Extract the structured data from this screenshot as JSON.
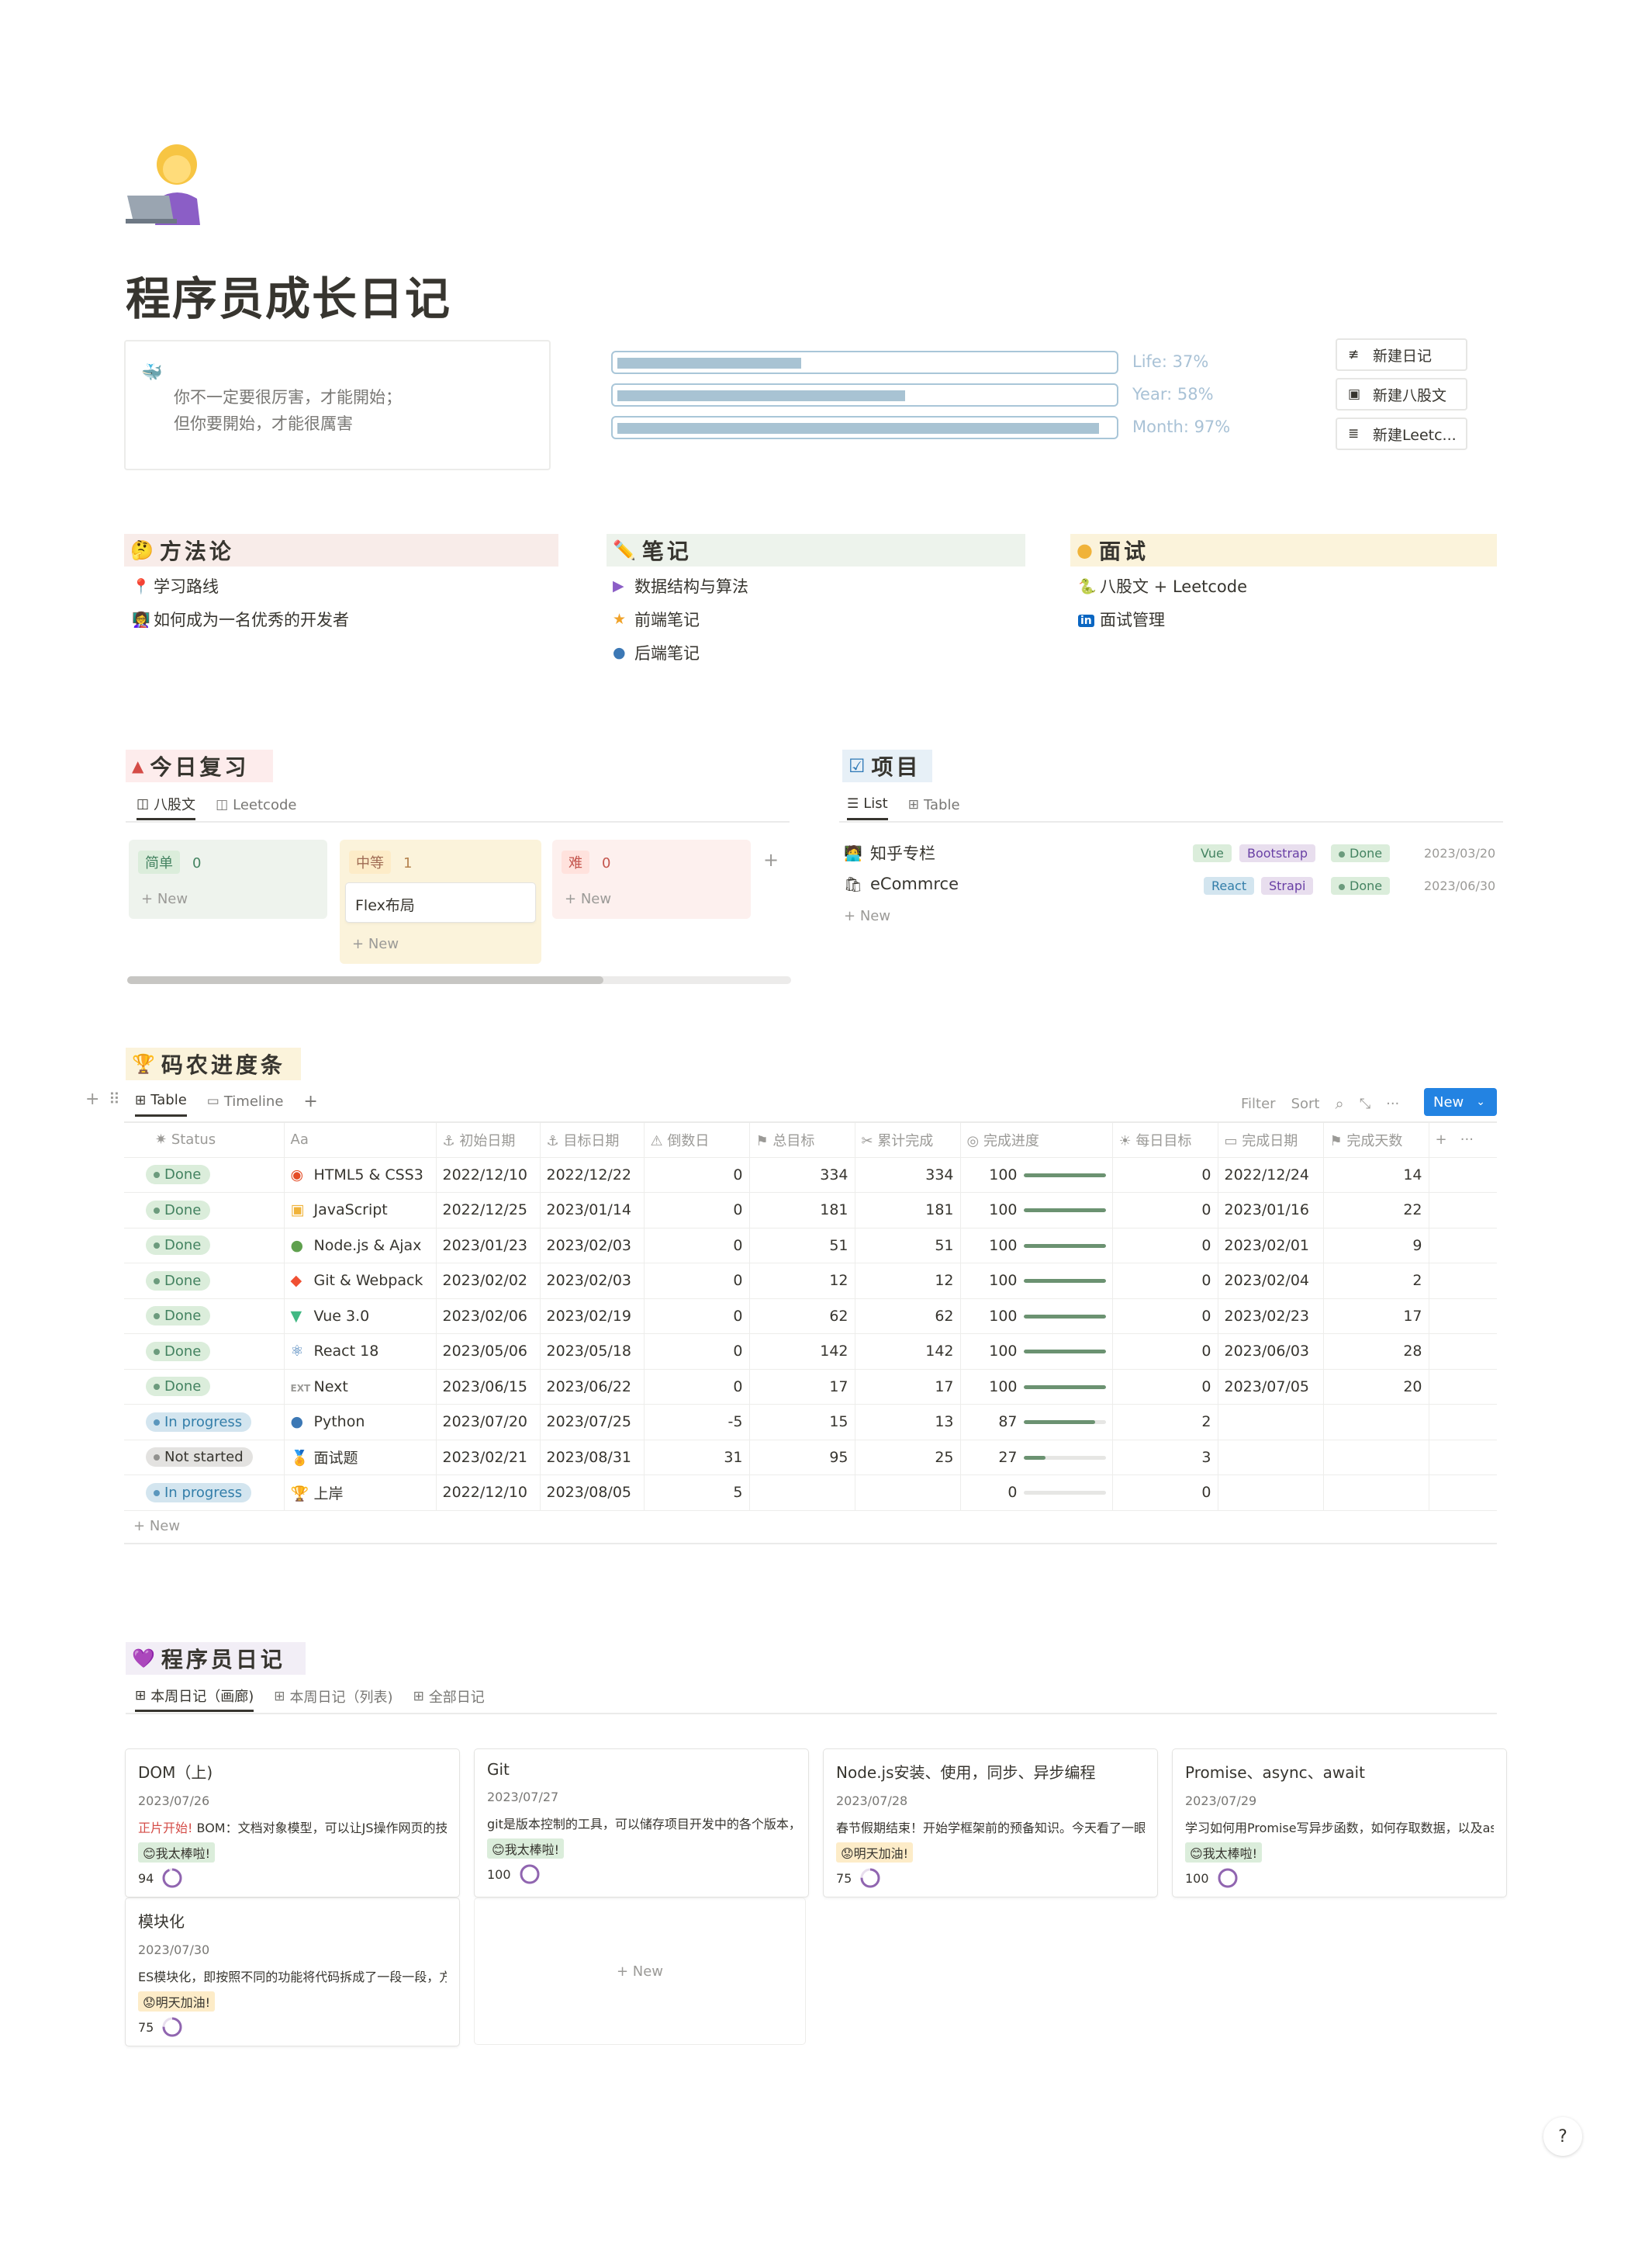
{
  "page": {
    "title": "程序员成长日记"
  },
  "quote": {
    "icon": "whale-icon",
    "line1": "你不一定要很厉害，才能開始；",
    "line2": "但你要開始，才能很厲害"
  },
  "progress": [
    {
      "label": "Life: 37%",
      "value": 0.37
    },
    {
      "label": "Year: 58%",
      "value": 0.58
    },
    {
      "label": "Month: 97%",
      "value": 0.97
    }
  ],
  "quick_buttons": [
    {
      "icon": "new-note-icon",
      "label": "新建日记"
    },
    {
      "icon": "terminal-icon",
      "label": "新建八股文"
    },
    {
      "icon": "database-icon",
      "label": "新建Leetc..."
    }
  ],
  "sections": {
    "method": {
      "icon": "🤔",
      "title": "方法论",
      "color": "#f8ece9",
      "links": [
        {
          "icon": "📍",
          "label": "学习路线"
        },
        {
          "icon": "👩‍🏫",
          "label": "如何成为一名优秀的开发者"
        }
      ]
    },
    "notes": {
      "icon": "✏️",
      "title": "笔记",
      "color": "#edf3ec",
      "links": [
        {
          "icon": "▶",
          "label": "数据结构与算法"
        },
        {
          "icon": "★",
          "label": "前端笔记"
        },
        {
          "icon": "●",
          "label": "后端笔记"
        }
      ]
    },
    "interview": {
      "icon": "●",
      "title": "面试",
      "color": "#fbf3db",
      "links": [
        {
          "icon": "🐍",
          "label": "八股文 + Leetcode"
        },
        {
          "icon": "in",
          "label": "面试管理"
        }
      ]
    }
  },
  "review": {
    "title": "今日复习",
    "icon": "▲",
    "tabs": [
      "八股文",
      "Leetcode"
    ],
    "columns": [
      {
        "name": "简单",
        "count": "0",
        "bg": "#eef3ed",
        "tag_bg": "#dbeddb",
        "tag_color": "#448361",
        "cards": [],
        "new_label": "New"
      },
      {
        "name": "中等",
        "count": "1",
        "bg": "#fbf3db",
        "tag_bg": "#fdecc8",
        "tag_color": "#9f6b53",
        "cards": [
          "Flex布局"
        ],
        "new_label": "New"
      },
      {
        "name": "难",
        "count": "0",
        "bg": "#fdf0ee",
        "tag_bg": "#ffe2dd",
        "tag_color": "#c4554d",
        "cards": [],
        "new_label": "New"
      }
    ]
  },
  "projects": {
    "title": "项目",
    "icon": "☑",
    "tabs": [
      "List",
      "Table"
    ],
    "rows": [
      {
        "icon": "🧑‍💻",
        "name": "知乎专栏",
        "tags": [
          "Vue",
          "Bootstrap"
        ],
        "status": "Done",
        "date": "2023/03/20"
      },
      {
        "icon": "🛍",
        "name": "eCommrce",
        "tags": [
          "React",
          "Strapi"
        ],
        "status": "Done",
        "date": "2023/06/30"
      }
    ],
    "new_label": "New"
  },
  "tracker": {
    "title": "码农进度条",
    "icon": "🏆",
    "tabs": [
      "Table",
      "Timeline"
    ],
    "toolbar": {
      "filter": "Filter",
      "sort": "Sort",
      "new": "New"
    },
    "headers": [
      "Status",
      "Aa",
      "初始日期",
      "目标日期",
      "倒数日",
      "总目标",
      "累计完成",
      "完成进度",
      "每日目标",
      "完成日期",
      "完成天数"
    ],
    "rows": [
      {
        "status": "Done",
        "icon": "html-icon",
        "name": "HTML5 & CSS3",
        "start": "2022/12/10",
        "target": "2022/12/22",
        "countdown": "0",
        "total": "334",
        "done": "334",
        "progress": "100",
        "daily": "0",
        "finish": "2022/12/24",
        "days": "14"
      },
      {
        "status": "Done",
        "icon": "js-icon",
        "name": "JavaScript",
        "start": "2022/12/25",
        "target": "2023/01/14",
        "countdown": "0",
        "total": "181",
        "done": "181",
        "progress": "100",
        "daily": "0",
        "finish": "2023/01/16",
        "days": "22"
      },
      {
        "status": "Done",
        "icon": "node-icon",
        "name": "Node.js & Ajax",
        "start": "2023/01/23",
        "target": "2023/02/03",
        "countdown": "0",
        "total": "51",
        "done": "51",
        "progress": "100",
        "daily": "0",
        "finish": "2023/02/01",
        "days": "9"
      },
      {
        "status": "Done",
        "icon": "git-icon",
        "name": "Git & Webpack",
        "start": "2023/02/02",
        "target": "2023/02/03",
        "countdown": "0",
        "total": "12",
        "done": "12",
        "progress": "100",
        "daily": "0",
        "finish": "2023/02/04",
        "days": "2"
      },
      {
        "status": "Done",
        "icon": "vue-icon",
        "name": "Vue 3.0",
        "start": "2023/02/06",
        "target": "2023/02/19",
        "countdown": "0",
        "total": "62",
        "done": "62",
        "progress": "100",
        "daily": "0",
        "finish": "2023/02/23",
        "days": "17"
      },
      {
        "status": "Done",
        "icon": "react-icon",
        "name": "React 18",
        "start": "2023/05/06",
        "target": "2023/05/18",
        "countdown": "0",
        "total": "142",
        "done": "142",
        "progress": "100",
        "daily": "0",
        "finish": "2023/06/03",
        "days": "28"
      },
      {
        "status": "Done",
        "icon": "ext-icon",
        "name": "Next",
        "start": "2023/06/15",
        "target": "2023/06/22",
        "countdown": "0",
        "total": "17",
        "done": "17",
        "progress": "100",
        "daily": "0",
        "finish": "2023/07/05",
        "days": "20"
      },
      {
        "status": "In progress",
        "icon": "python-icon",
        "name": "Python",
        "start": "2023/07/20",
        "target": "2023/07/25",
        "countdown": "-5",
        "total": "15",
        "done": "13",
        "progress": "87",
        "daily": "2",
        "finish": "",
        "days": ""
      },
      {
        "status": "Not started",
        "icon": "medal-icon",
        "name": "面试题",
        "start": "2023/02/21",
        "target": "2023/08/31",
        "countdown": "31",
        "total": "95",
        "done": "25",
        "progress": "27",
        "daily": "3",
        "finish": "",
        "days": ""
      },
      {
        "status": "In progress",
        "icon": "trophy-icon",
        "name": "上岸",
        "start": "2022/12/10",
        "target": "2023/08/05",
        "countdown": "5",
        "total": "",
        "done": "",
        "progress": "0",
        "daily": "0",
        "finish": "",
        "days": ""
      }
    ],
    "new_label": "New"
  },
  "diary": {
    "title": "程序员日记",
    "icon": "💜",
    "tabs": [
      "本周日记（画廊)",
      "本周日记（列表)",
      "全部日记"
    ],
    "cards": [
      {
        "title": "DOM（上)",
        "date": "2023/07/26",
        "hl": "正片开始!",
        "excerpt": " BOM：文档对象模型，可以让JS操作网页的技术",
        "mood": "😊我太棒啦!",
        "mood_bg": "#dbeddb",
        "score": "94",
        "pct": 0.94
      },
      {
        "title": "Git",
        "date": "2023/07/27",
        "hl": "",
        "excerpt": "git是版本控制的工具，可以储存项目开发中的各个版本，让",
        "mood": "😊我太棒啦!",
        "mood_bg": "#dbeddb",
        "score": "100",
        "pct": 1
      },
      {
        "title": "Node.js安装、使用，同步、异步编程",
        "date": "2023/07/28",
        "hl": "",
        "excerpt": "春节假期结束！开始学框架前的预备知识。今天看了一眼",
        "mood": "😟明天加油!",
        "mood_bg": "#fdecc8",
        "score": "75",
        "pct": 0.75
      },
      {
        "title": "Promise、async、await",
        "date": "2023/07/29",
        "hl": "",
        "excerpt": "学习如何用Promise写异步函数，如何存取数据，以及async",
        "mood": "😊我太棒啦!",
        "mood_bg": "#dbeddb",
        "score": "100",
        "pct": 1
      },
      {
        "title": "模块化",
        "date": "2023/07/30",
        "hl": "",
        "excerpt": "ES模块化，即按照不同的功能将代码拆成了一段一段，方便",
        "mood": "😟明天加油!",
        "mood_bg": "#fdecc8",
        "score": "75",
        "pct": 0.75
      }
    ],
    "new_label": "New"
  },
  "help": "?"
}
